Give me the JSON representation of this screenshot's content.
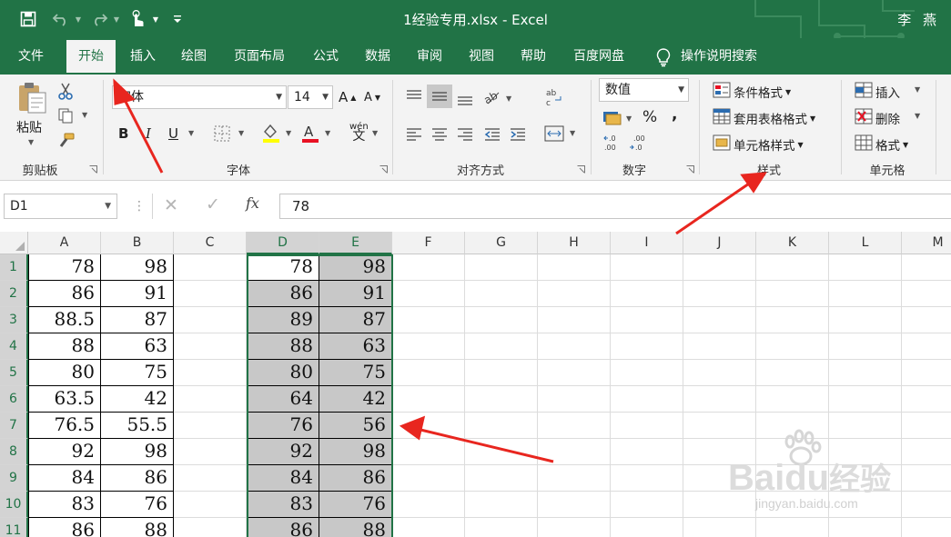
{
  "titlebar": {
    "title": "1经验专用.xlsx  -  Excel",
    "user": "李 燕",
    "bg_color": "#217346"
  },
  "tabs": [
    {
      "label": "文件"
    },
    {
      "label": "开始"
    },
    {
      "label": "插入"
    },
    {
      "label": "绘图"
    },
    {
      "label": "页面布局"
    },
    {
      "label": "公式"
    },
    {
      "label": "数据"
    },
    {
      "label": "审阅"
    },
    {
      "label": "视图"
    },
    {
      "label": "帮助"
    },
    {
      "label": "百度网盘"
    }
  ],
  "tell_me": "操作说明搜索",
  "ribbon": {
    "clipboard": {
      "paste": "粘贴",
      "label": "剪贴板"
    },
    "font": {
      "name": "宋体",
      "size": "14",
      "label": "字体",
      "bold": "B",
      "italic": "I",
      "underline": "U",
      "phonetic": "wén"
    },
    "alignment": {
      "label": "对齐方式"
    },
    "number": {
      "format": "数值",
      "label": "数字"
    },
    "styles": {
      "conditional": "条件格式",
      "table": "套用表格格式",
      "cell": "单元格样式",
      "label": "样式"
    },
    "cells": {
      "insert": "插入",
      "delete": "删除",
      "format": "格式",
      "label": "单元格"
    }
  },
  "formula_bar": {
    "name_box": "D1",
    "fx": "fx",
    "value": "78"
  },
  "columns": [
    "A",
    "B",
    "C",
    "D",
    "E",
    "F",
    "G",
    "H",
    "I",
    "J",
    "K",
    "L",
    "M"
  ],
  "rows": [
    {
      "num": "1",
      "A": "78",
      "B": "98",
      "D": "78",
      "E": "98"
    },
    {
      "num": "2",
      "A": "86",
      "B": "91",
      "D": "86",
      "E": "91"
    },
    {
      "num": "3",
      "A": "88.5",
      "B": "87",
      "D": "89",
      "E": "87"
    },
    {
      "num": "4",
      "A": "88",
      "B": "63",
      "D": "88",
      "E": "63"
    },
    {
      "num": "5",
      "A": "80",
      "B": "75",
      "D": "80",
      "E": "75"
    },
    {
      "num": "6",
      "A": "63.5",
      "B": "42",
      "D": "64",
      "E": "42"
    },
    {
      "num": "7",
      "A": "76.5",
      "B": "55.5",
      "D": "76",
      "E": "56"
    },
    {
      "num": "8",
      "A": "92",
      "B": "98",
      "D": "92",
      "E": "98"
    },
    {
      "num": "9",
      "A": "84",
      "B": "86",
      "D": "84",
      "E": "86"
    },
    {
      "num": "10",
      "A": "83",
      "B": "76",
      "D": "83",
      "E": "76"
    },
    {
      "num": "11",
      "A": "86",
      "B": "88",
      "D": "86",
      "E": "88"
    }
  ],
  "selection": {
    "range": "D1:E11",
    "color": "#217346"
  },
  "annotation_color": "#e8261f",
  "watermark": {
    "brand": "Baidu",
    "word": "经验",
    "url": "jingyan.baidu.com"
  }
}
